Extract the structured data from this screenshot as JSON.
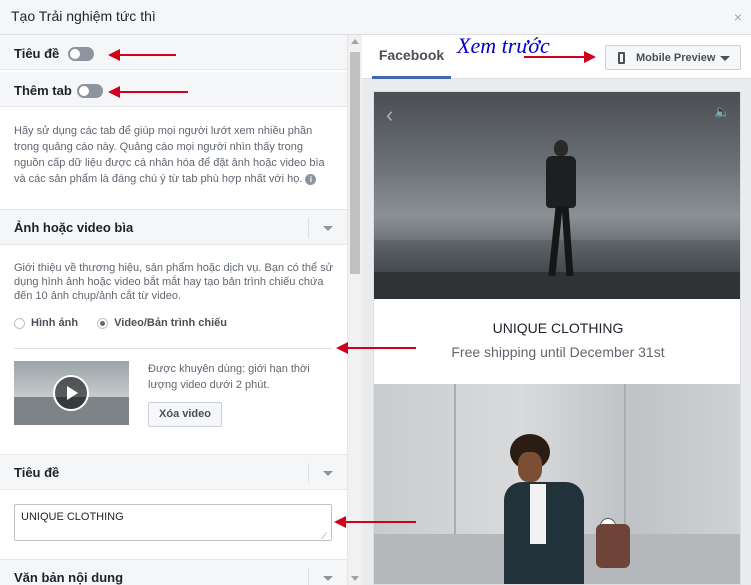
{
  "dialog": {
    "title": "Tạo Trải nghiệm tức thì",
    "close_glyph": "×"
  },
  "left": {
    "toggle_title_label": "Tiêu đề",
    "toggle_tabs_label": "Thêm tab",
    "tabs_help": "Hãy sử dụng các tab để giúp mọi người lướt xem nhiều phần trong quảng cáo này. Quảng cáo mọi người nhìn thấy trong nguồn cấp dữ liệu được cá nhân hóa để đặt ảnh hoặc video bìa và các sản phẩm là đáng chú ý từ tab phù hợp nhất với họ.",
    "info_glyph": "i",
    "cover_section_label": "Ảnh hoặc video bìa",
    "cover_description": "Giới thiệu về thương hiệu, sản phẩm hoặc dịch vụ. Bạn có thể sử dụng hình ảnh hoặc video bắt mắt hay tạo bản trình chiếu chứa đến 10 ảnh chụp/ảnh cắt từ video.",
    "radio_image_label": "Hình ảnh",
    "radio_video_label": "Video/Bản trình chiếu",
    "recommend_text": "Được khuyên dùng: giới hạn thời lượng video dưới 2 phút.",
    "delete_video_button": "Xóa video",
    "headline_section_label": "Tiêu đề",
    "headline_value": "UNIQUE CLOTHING",
    "body_section_label": "Văn bản nội dung"
  },
  "right": {
    "tab_facebook": "Facebook",
    "preview_annotation": "Xem trước",
    "mobile_preview_button": "Mobile Preview",
    "preview_brand": "UNIQUE CLOTHING",
    "preview_promo": "Free shipping until December 31st",
    "prev_glyph": "‹",
    "speaker_glyph": "🔈"
  },
  "colors": {
    "accent_tab": "#4267b2",
    "annotation_arrow": "#d0021b",
    "annotation_text": "#0000cc"
  }
}
